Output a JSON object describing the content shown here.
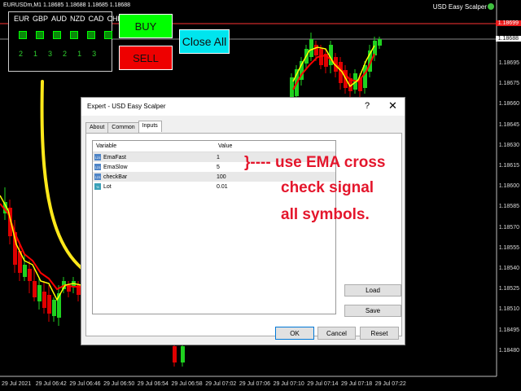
{
  "header": {
    "symbol_info": "EURUSDm,M1  1.18685 1.18688 1.18685 1.18688",
    "ea_name": "USD Easy Scalper"
  },
  "panel": {
    "symbols": [
      "EUR",
      "GBP",
      "AUD",
      "NZD",
      "CAD",
      "CHF"
    ],
    "counts": [
      "2",
      "1",
      "3",
      "2",
      "1",
      "3"
    ]
  },
  "buttons": {
    "buy": "BUY",
    "sell": "SELL",
    "close_all": "Close All"
  },
  "price_axis": {
    "labels": [
      "1.18695",
      "1.18675",
      "1.18660",
      "1.18645",
      "1.18630",
      "1.18615",
      "1.18600",
      "1.18585",
      "1.18570",
      "1.18555",
      "1.18540",
      "1.18525",
      "1.18510",
      "1.18495",
      "1.18480"
    ],
    "badge_red": "1.18699",
    "badge_white": "1.18688"
  },
  "time_axis": {
    "labels": [
      "29 Jul 2021",
      "29 Jul 06:42",
      "29 Jul 06:46",
      "29 Jul 06:50",
      "29 Jul 06:54",
      "29 Jul 06:58",
      "29 Jul 07:02",
      "29 Jul 07:06",
      "29 Jul 07:10",
      "29 Jul 07:14",
      "29 Jul 07:18",
      "29 Jul 07:22"
    ]
  },
  "dialog": {
    "title": "Expert - USD Easy Scalper",
    "help": "?",
    "close": "✕",
    "tabs": [
      "About",
      "Common",
      "Inputs"
    ],
    "columns": {
      "variable": "Variable",
      "value": "Value"
    },
    "inputs": [
      {
        "icon": "123",
        "name": "EmaFast",
        "value": "1"
      },
      {
        "icon": "123",
        "name": "EmaSlow",
        "value": "5"
      },
      {
        "icon": "123",
        "name": "checkBar",
        "value": "100"
      },
      {
        "icon": "½",
        "name": "Lot",
        "value": "0.01"
      }
    ],
    "load": "Load",
    "save": "Save",
    "ok": "OK",
    "cancel": "Cancel",
    "reset": "Reset"
  },
  "annotation": {
    "line1": "}---- use EMA cross",
    "line2": "check signal",
    "line3": "all symbols."
  },
  "colors": {
    "bull": "#1fd11f",
    "bear": "#e00000",
    "ema_fast": "#ffff00",
    "ema_slow": "#ff0000",
    "annotation": "#e4162c"
  }
}
